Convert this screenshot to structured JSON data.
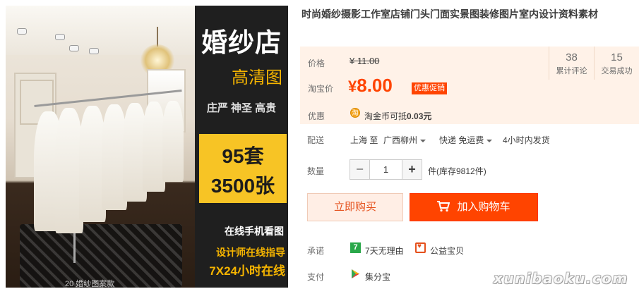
{
  "product": {
    "title": "时尚婚纱摄影工作室店铺门头门面实景图装修图片室内设计资料素材",
    "image": {
      "banner_title": "婚纱店",
      "banner_hd": "高清图",
      "banner_tagline": "庄严 神圣 高贵",
      "banner_sets": "95套",
      "banner_photos": "3500张",
      "banner_mobile": "在线手机看图",
      "banner_guide": "设计师在线指导",
      "banner_hours": "7X24小时在线",
      "photo_watermark": "20 婚纱图案款"
    }
  },
  "price": {
    "label": "价格",
    "original": "¥ 11.00",
    "promo_label": "淘宝价",
    "promo_currency": "¥",
    "promo_value": "8.00",
    "promo_tag": "优惠促销"
  },
  "stats": {
    "reviews_count": "38",
    "reviews_label": "累计评论",
    "sales_count": "15",
    "sales_label": "交易成功"
  },
  "perk": {
    "label": "优惠",
    "icon": "coin-icon",
    "icon_char": "淘",
    "text_prefix": "淘金币可抵",
    "text_amount": "0.03元"
  },
  "shipping": {
    "label": "配送",
    "from": "上海 至",
    "to": "广西柳州",
    "method": "快递 免运费",
    "time": "4小时内发货"
  },
  "quantity": {
    "label": "数量",
    "minus": "−",
    "value": "1",
    "plus": "+",
    "stock": "件(库存9812件)"
  },
  "actions": {
    "buy_now": "立即购买",
    "add_to_cart": "加入购物车"
  },
  "promise": {
    "label": "承诺",
    "seven_day_icon": "7",
    "seven_day": "7天无理由",
    "charity": "公益宝贝"
  },
  "payment": {
    "label": "支付",
    "method": "集分宝"
  },
  "watermark": "xunibaoku.com",
  "colors": {
    "accent": "#ff4400",
    "price_bg": "#fff2e8",
    "banner_yellow": "#f7c425"
  }
}
